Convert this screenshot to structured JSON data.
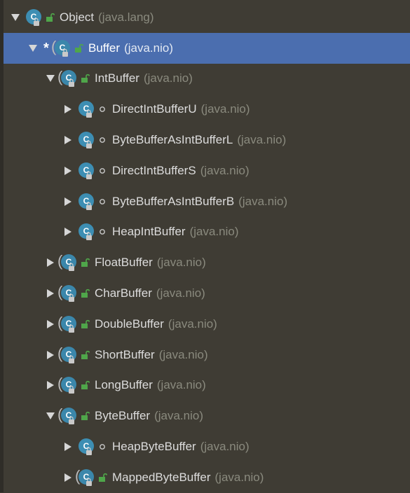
{
  "tree": {
    "nodes": [
      {
        "name": "Object",
        "package": "(java.lang)",
        "level": 0,
        "expanded": true,
        "selected": false,
        "current": false,
        "visibility": "public",
        "abstract": false
      },
      {
        "name": "Buffer",
        "package": "(java.nio)",
        "level": 1,
        "expanded": true,
        "selected": true,
        "current": true,
        "visibility": "public",
        "abstract": true
      },
      {
        "name": "IntBuffer",
        "package": "(java.nio)",
        "level": 2,
        "expanded": true,
        "selected": false,
        "current": false,
        "visibility": "public",
        "abstract": true
      },
      {
        "name": "DirectIntBufferU",
        "package": "(java.nio)",
        "level": 3,
        "expanded": false,
        "selected": false,
        "current": false,
        "visibility": "package",
        "abstract": false
      },
      {
        "name": "ByteBufferAsIntBufferL",
        "package": "(java.nio)",
        "level": 3,
        "expanded": false,
        "selected": false,
        "current": false,
        "visibility": "package",
        "abstract": false
      },
      {
        "name": "DirectIntBufferS",
        "package": "(java.nio)",
        "level": 3,
        "expanded": false,
        "selected": false,
        "current": false,
        "visibility": "package",
        "abstract": false
      },
      {
        "name": "ByteBufferAsIntBufferB",
        "package": "(java.nio)",
        "level": 3,
        "expanded": false,
        "selected": false,
        "current": false,
        "visibility": "package",
        "abstract": false
      },
      {
        "name": "HeapIntBuffer",
        "package": "(java.nio)",
        "level": 3,
        "expanded": false,
        "selected": false,
        "current": false,
        "visibility": "package",
        "abstract": false
      },
      {
        "name": "FloatBuffer",
        "package": "(java.nio)",
        "level": 2,
        "expanded": false,
        "selected": false,
        "current": false,
        "visibility": "public",
        "abstract": true
      },
      {
        "name": "CharBuffer",
        "package": "(java.nio)",
        "level": 2,
        "expanded": false,
        "selected": false,
        "current": false,
        "visibility": "public",
        "abstract": true
      },
      {
        "name": "DoubleBuffer",
        "package": "(java.nio)",
        "level": 2,
        "expanded": false,
        "selected": false,
        "current": false,
        "visibility": "public",
        "abstract": true
      },
      {
        "name": "ShortBuffer",
        "package": "(java.nio)",
        "level": 2,
        "expanded": false,
        "selected": false,
        "current": false,
        "visibility": "public",
        "abstract": true
      },
      {
        "name": "LongBuffer",
        "package": "(java.nio)",
        "level": 2,
        "expanded": false,
        "selected": false,
        "current": false,
        "visibility": "public",
        "abstract": true
      },
      {
        "name": "ByteBuffer",
        "package": "(java.nio)",
        "level": 2,
        "expanded": true,
        "selected": false,
        "current": false,
        "visibility": "public",
        "abstract": true
      },
      {
        "name": "HeapByteBuffer",
        "package": "(java.nio)",
        "level": 3,
        "expanded": false,
        "selected": false,
        "current": false,
        "visibility": "package",
        "abstract": false
      },
      {
        "name": "MappedByteBuffer",
        "package": "(java.nio)",
        "level": 3,
        "expanded": false,
        "selected": false,
        "current": false,
        "visibility": "public",
        "abstract": true
      }
    ],
    "current_marker": "*",
    "class_icon_letter": "C",
    "colors": {
      "background": "#3f3c34",
      "selection": "#4b6eaf",
      "class_icon": "#3d8eb3",
      "lock_green": "#4fa64a",
      "text": "#dcdcdc",
      "package_text": "#8a8a7e"
    },
    "icons": {
      "expanded": "arrow-down-icon",
      "collapsed": "arrow-right-icon",
      "class": "class-icon",
      "public": "unlocked-padlock-icon",
      "package": "package-private-dot-icon"
    }
  }
}
